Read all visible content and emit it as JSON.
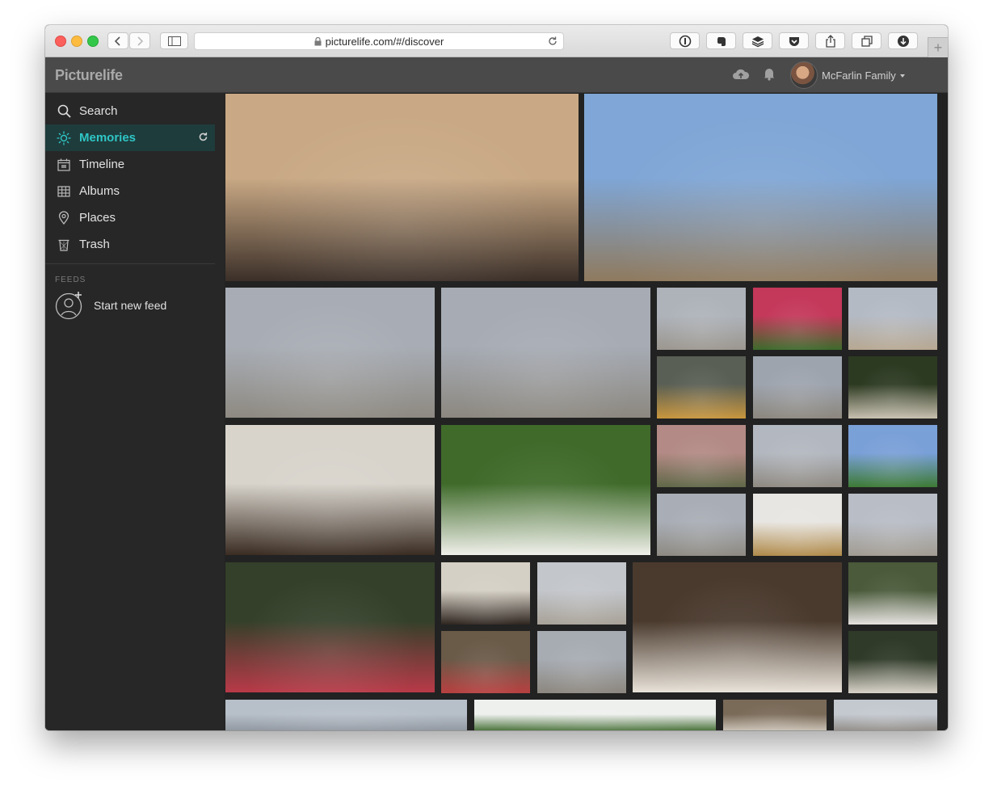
{
  "browser": {
    "url": "picturelife.com/#/discover",
    "new_tab_label": "+"
  },
  "app": {
    "logo": "Picturelife",
    "user_name": "McFarlin Family"
  },
  "sidebar": {
    "items": [
      {
        "label": "Search",
        "icon": "search-icon"
      },
      {
        "label": "Memories",
        "icon": "sun-icon",
        "active": true
      },
      {
        "label": "Timeline",
        "icon": "calendar-icon"
      },
      {
        "label": "Albums",
        "icon": "albums-grid-icon"
      },
      {
        "label": "Places",
        "icon": "map-pin-icon"
      },
      {
        "label": "Trash",
        "icon": "trash-icon"
      }
    ],
    "feeds_heading": "FEEDS",
    "new_feed_label": "Start new feed"
  },
  "colors": {
    "accent": "#2fc6c6",
    "active_bg": "#1f3c3c",
    "sidebar_bg": "#272727",
    "header_bg": "#4a4a4a",
    "grid_bg": "#222222"
  },
  "photos": [
    {
      "subject": "grandfather-with-baby",
      "c1": "#c9a985",
      "c2": "#3b2f28"
    },
    {
      "subject": "man-by-pine-trees",
      "c1": "#7fa6d6",
      "c2": "#8f7a5e"
    },
    {
      "subject": "family-on-beach",
      "c1": "#a8adb5",
      "c2": "#8e8a82"
    },
    {
      "subject": "family-on-beach",
      "c1": "#a6abb4",
      "c2": "#8c8880"
    },
    {
      "subject": "family-on-beach",
      "c1": "#aeb3ba",
      "c2": "#9c9790"
    },
    {
      "subject": "girl-in-flowers",
      "c1": "#c4385a",
      "c2": "#3d6b2c"
    },
    {
      "subject": "couple-on-beach",
      "c1": "#b4bac4",
      "c2": "#b7a892"
    },
    {
      "subject": "gym-room",
      "c1": "#5a5f55",
      "c2": "#c8963e"
    },
    {
      "subject": "family-on-beach",
      "c1": "#9ea4ae",
      "c2": "#8c877e"
    },
    {
      "subject": "baptism-garden",
      "c1": "#2d3a22",
      "c2": "#c8c0b0"
    },
    {
      "subject": "baptism-in-church",
      "c1": "#d8d4cc",
      "c2": "#3a2c22"
    },
    {
      "subject": "dogwood-flowers",
      "c1": "#3f6a2a",
      "c2": "#f0f0ea"
    },
    {
      "subject": "girl-by-rocks",
      "c1": "#b38a85",
      "c2": "#606848"
    },
    {
      "subject": "family-on-beach",
      "c1": "#b3b8c0",
      "c2": "#8f8a82"
    },
    {
      "subject": "garden-statue",
      "c1": "#7aa0d8",
      "c2": "#3d7a35"
    },
    {
      "subject": "family-on-beach",
      "c1": "#a9aeb6",
      "c2": "#8e8a82"
    },
    {
      "subject": "gym-room",
      "c1": "#e8e6e2",
      "c2": "#b08a4a"
    },
    {
      "subject": "family-on-beach",
      "c1": "#b8bdc6",
      "c2": "#a29c92"
    },
    {
      "subject": "family-in-garden",
      "c1": "#34402a",
      "c2": "#b83a48"
    },
    {
      "subject": "baptism-in-church",
      "c1": "#d5d0c5",
      "c2": "#2f2620"
    },
    {
      "subject": "family-on-beach",
      "c1": "#c3c6cb",
      "c2": "#a8a298"
    },
    {
      "subject": "baptism-closeup",
      "c1": "#4a3a2e",
      "c2": "#e8e2d8"
    },
    {
      "subject": "woman-with-baby",
      "c1": "#4a5a3a",
      "c2": "#e6e2e0"
    },
    {
      "subject": "family-portrait",
      "c1": "#6a5a48",
      "c2": "#b84040"
    },
    {
      "subject": "family-on-beach",
      "c1": "#a7acb3",
      "c2": "#8c877f"
    },
    {
      "subject": "baptism-garden",
      "c1": "#2f3a28",
      "c2": "#d8d2c8"
    },
    {
      "subject": "beach-sky",
      "c1": "#b7bfc9",
      "c2": "#8e959e"
    },
    {
      "subject": "trees-and-sky",
      "c1": "#eef0ee",
      "c2": "#3f6a2f"
    },
    {
      "subject": "couple-by-building",
      "c1": "#7a6a58",
      "c2": "#d0c8bc"
    },
    {
      "subject": "beach-sky",
      "c1": "#c4c9d0",
      "c2": "#8f8a84"
    }
  ]
}
